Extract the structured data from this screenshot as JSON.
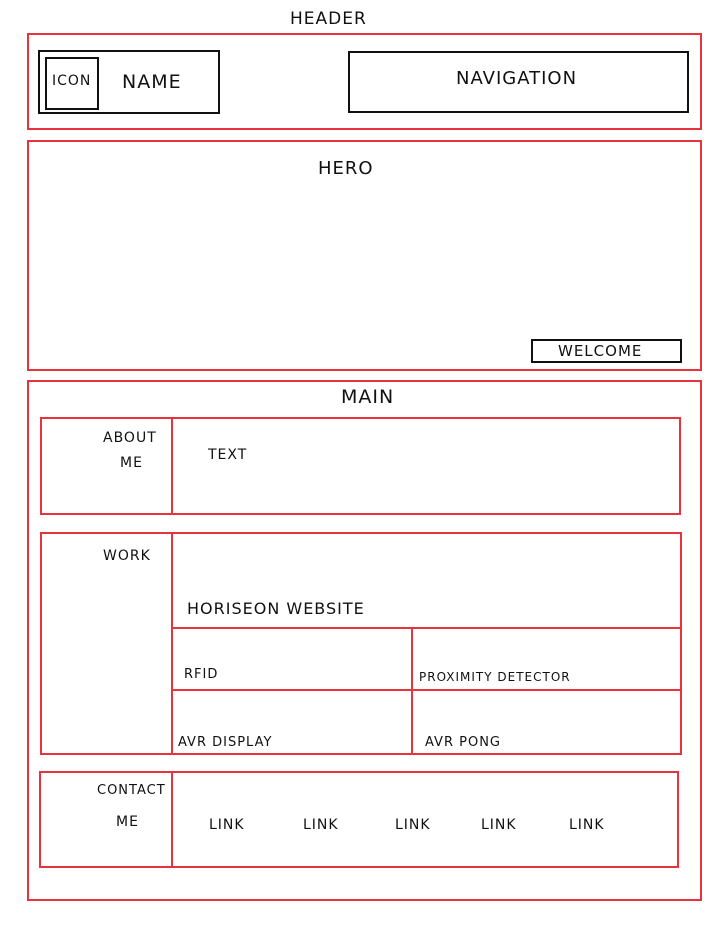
{
  "header": {
    "title": "HEADER",
    "icon_label": "ICON",
    "name_label": "NAME",
    "navigation_label": "NAVIGATION"
  },
  "hero": {
    "title": "HERO",
    "welcome_label": "WELCOME"
  },
  "main": {
    "title": "MAIN",
    "about": {
      "label_line1": "ABOUT",
      "label_line2": "ME",
      "text": "TEXT"
    },
    "work": {
      "label": "WORK",
      "featured": "HORISEON WEBSITE",
      "items": [
        "RFID",
        "PROXIMITY DETECTOR",
        "AVR DISPLAY",
        "AVR PONG"
      ]
    },
    "contact": {
      "label_line1": "CONTACT",
      "label_line2": "ME",
      "links": [
        "LINK",
        "LINK",
        "LINK",
        "LINK",
        "LINK"
      ]
    }
  },
  "colors": {
    "section_border": "#e8323c",
    "element_border": "#111111"
  }
}
